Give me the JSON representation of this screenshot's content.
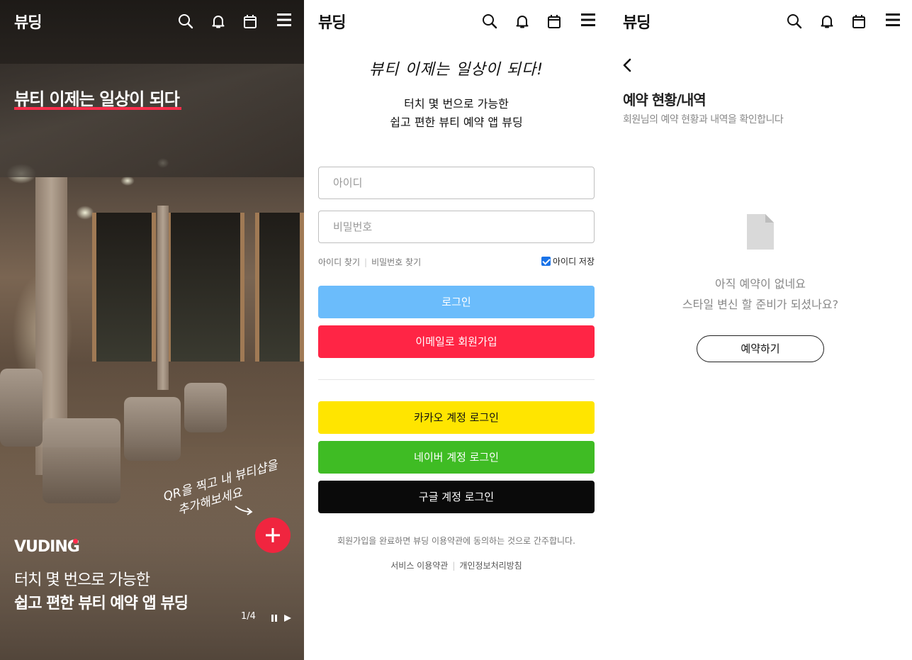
{
  "app": {
    "logo": "뷰딩"
  },
  "header": {
    "icons": [
      "search-icon",
      "bell-icon",
      "calendar-icon",
      "menu-icon"
    ]
  },
  "hero": {
    "tagline": "뷰티 이제는 일상이 되다",
    "handwritten_line1": "QR을 찍고 내 뷰티샵을",
    "handwritten_line2": "추가해보세요",
    "brand": "VUDING",
    "subtitle_line1": "터치 몇 번으로 가능한",
    "subtitle_line2": "쉽고 편한 뷰티 예약 앱 뷰딩",
    "pager": "1/4",
    "accent_color": "#ff2d4b"
  },
  "login": {
    "title": "뷰티 이제는 일상이 되다!",
    "intro_line1": "터치 몇 번으로 가능한",
    "intro_line2": "쉽고 편한 뷰티 예약 앱 뷰딩",
    "id_placeholder": "아이디",
    "password_placeholder": "비밀번호",
    "find_id": "아이디 찾기",
    "find_password": "비밀번호 찾기",
    "remember_id": "아이디 저장",
    "remember_checked": true,
    "login_button": "로그인",
    "email_signup_button": "이메일로 회원가입",
    "kakao_button": "카카오 계정 로그인",
    "naver_button": "네이버 계정 로그인",
    "google_button": "구글 계정 로그인",
    "terms_note": "회원가입을 완료하면 뷰딩 이용약관에 동의하는 것으로 간주합니다.",
    "terms_of_service": "서비스 이용약관",
    "privacy_policy": "개인정보처리방침",
    "colors": {
      "login": "#6bbcfb",
      "email_signup": "#ff2545",
      "kakao": "#ffe500",
      "naver": "#3fbc24",
      "google": "#0a0a0a"
    }
  },
  "reservations": {
    "title": "예약 현황/내역",
    "subtitle": "회원님의 예약 현황과 내역을 확인합니다",
    "empty_line1": "아직 예약이 없네요",
    "empty_line2": "스타일 변신 할 준비가 되셨나요?",
    "reserve_button": "예약하기"
  }
}
